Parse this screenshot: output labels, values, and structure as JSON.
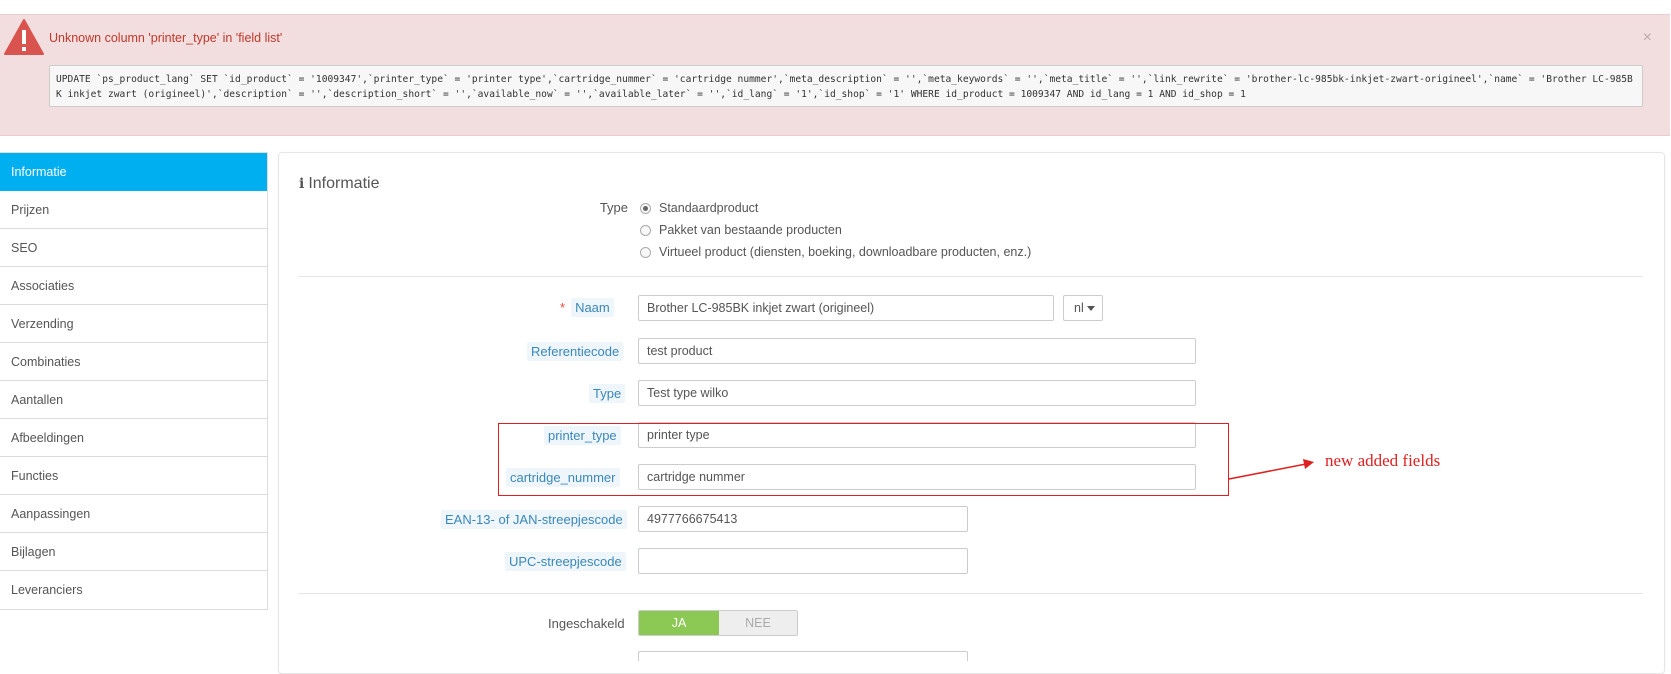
{
  "error": {
    "title": "Unknown column 'printer_type' in 'field list'",
    "close": "×",
    "sql": "UPDATE `ps_product_lang` SET `id_product` = '1009347',`printer_type` = 'printer type',`cartridge_nummer` = 'cartridge nummer',`meta_description` = '',`meta_keywords` = '',`meta_title` = '',`link_rewrite` = 'brother-lc-985bk-inkjet-zwart-origineel',`name` = 'Brother LC-985BK inkjet zwart (origineel)',`description` = '',`description_short` = '',`available_now` = '',`available_later` = '',`id_lang` = '1',`id_shop` = '1' WHERE id_product = 1009347 AND id_lang = 1 AND id_shop = 1"
  },
  "sidebar": {
    "items": [
      {
        "label": "Informatie",
        "active": true
      },
      {
        "label": "Prijzen"
      },
      {
        "label": "SEO"
      },
      {
        "label": "Associaties"
      },
      {
        "label": "Verzending"
      },
      {
        "label": "Combinaties"
      },
      {
        "label": "Aantallen"
      },
      {
        "label": "Afbeeldingen"
      },
      {
        "label": "Functies"
      },
      {
        "label": "Aanpassingen"
      },
      {
        "label": "Bijlagen"
      },
      {
        "label": "Leveranciers"
      }
    ]
  },
  "panel": {
    "title_icon": "i",
    "title": "Informatie",
    "type_label": "Type",
    "type_options": [
      {
        "label": "Standaardproduct",
        "checked": true
      },
      {
        "label": "Pakket van bestaande producten",
        "checked": false
      },
      {
        "label": "Virtueel product (diensten, boeking, downloadbare producten, enz.)",
        "checked": false
      }
    ],
    "fields": {
      "naam": {
        "required_mark": "*",
        "label": "Naam",
        "value": "Brother LC-985BK inkjet zwart (origineel)",
        "lang": "nl"
      },
      "referentiecode": {
        "label": "Referentiecode",
        "value": "test product"
      },
      "type": {
        "label": "Type",
        "value": "Test type wilko"
      },
      "printer_type": {
        "label": "printer_type",
        "value": "printer type"
      },
      "cartridge_nummer": {
        "label": "cartridge_nummer",
        "value": "cartridge nummer"
      },
      "ean13": {
        "label": "EAN-13- of JAN-streepjescode",
        "value": "4977766675413"
      },
      "upc": {
        "label": "UPC-streepjescode",
        "value": ""
      }
    },
    "ingeschakeld": {
      "label": "Ingeschakeld",
      "on": "JA",
      "off": "NEE",
      "value": "JA"
    }
  },
  "annotation": {
    "text": "new added fields",
    "color": "#e02020"
  },
  "colors": {
    "accent": "#00aff0",
    "error_bg": "#f2dede",
    "toggle_on": "#8bc954"
  }
}
